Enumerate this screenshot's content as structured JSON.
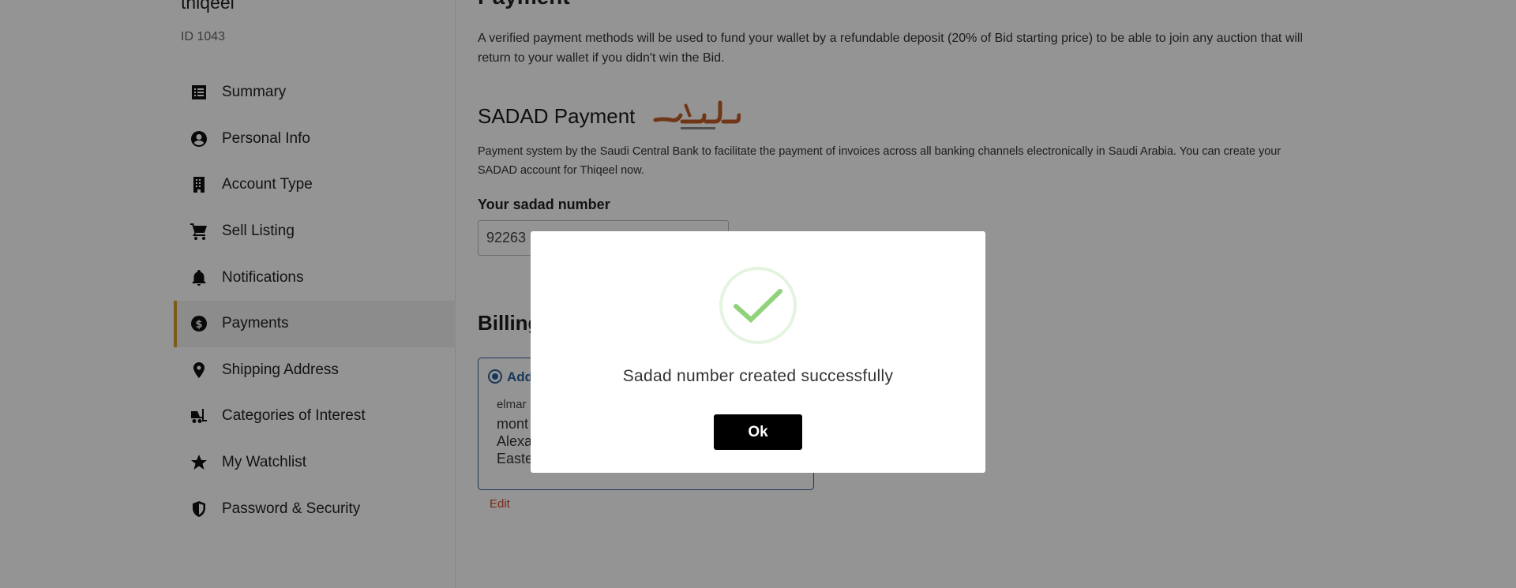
{
  "profile": {
    "name": "thiqeel",
    "id": "ID 1043"
  },
  "sidebar": {
    "items": [
      {
        "label": "Summary",
        "icon": "list-icon"
      },
      {
        "label": "Personal Info",
        "icon": "user-circle-icon"
      },
      {
        "label": "Account Type",
        "icon": "building-icon"
      },
      {
        "label": "Sell Listing",
        "icon": "cart-icon"
      },
      {
        "label": "Notifications",
        "icon": "bell-icon"
      },
      {
        "label": "Payments",
        "icon": "dollar-circle-icon",
        "active": true
      },
      {
        "label": "Shipping Address",
        "icon": "map-pin-icon"
      },
      {
        "label": "Categories of Interest",
        "icon": "forklift-icon"
      },
      {
        "label": "My Watchlist",
        "icon": "star-icon"
      },
      {
        "label": "Password & Security",
        "icon": "shield-icon"
      }
    ],
    "accent_color": "#d99a2b"
  },
  "main": {
    "section_title": "Payment",
    "intro": "A verified payment methods will be used to fund your wallet by a refundable deposit (20% of Bid starting price) to be able to join any auction that will return to your wallet if you didn't win the Bid.",
    "sadad_title": "SADAD Payment",
    "sadad_description": "Payment system by the Saudi Central Bank to facilitate the payment of invoices across all banking channels electronically in Saudi Arabia. You can create your SADAD account for Thiqeel now.",
    "sadad_number_label": "Your sadad number",
    "sadad_number_value": "92263",
    "billing_title": "Billing",
    "address_card": {
      "label": "Add",
      "name": "elmar",
      "lines": [
        "mont",
        "Alexa",
        "Easte"
      ],
      "border_color": "#2d5f99"
    },
    "edit_label": "Edit"
  },
  "modal": {
    "message": "Sadad number created successfully",
    "ok_label": "Ok",
    "check_color": "#8fd27a"
  }
}
